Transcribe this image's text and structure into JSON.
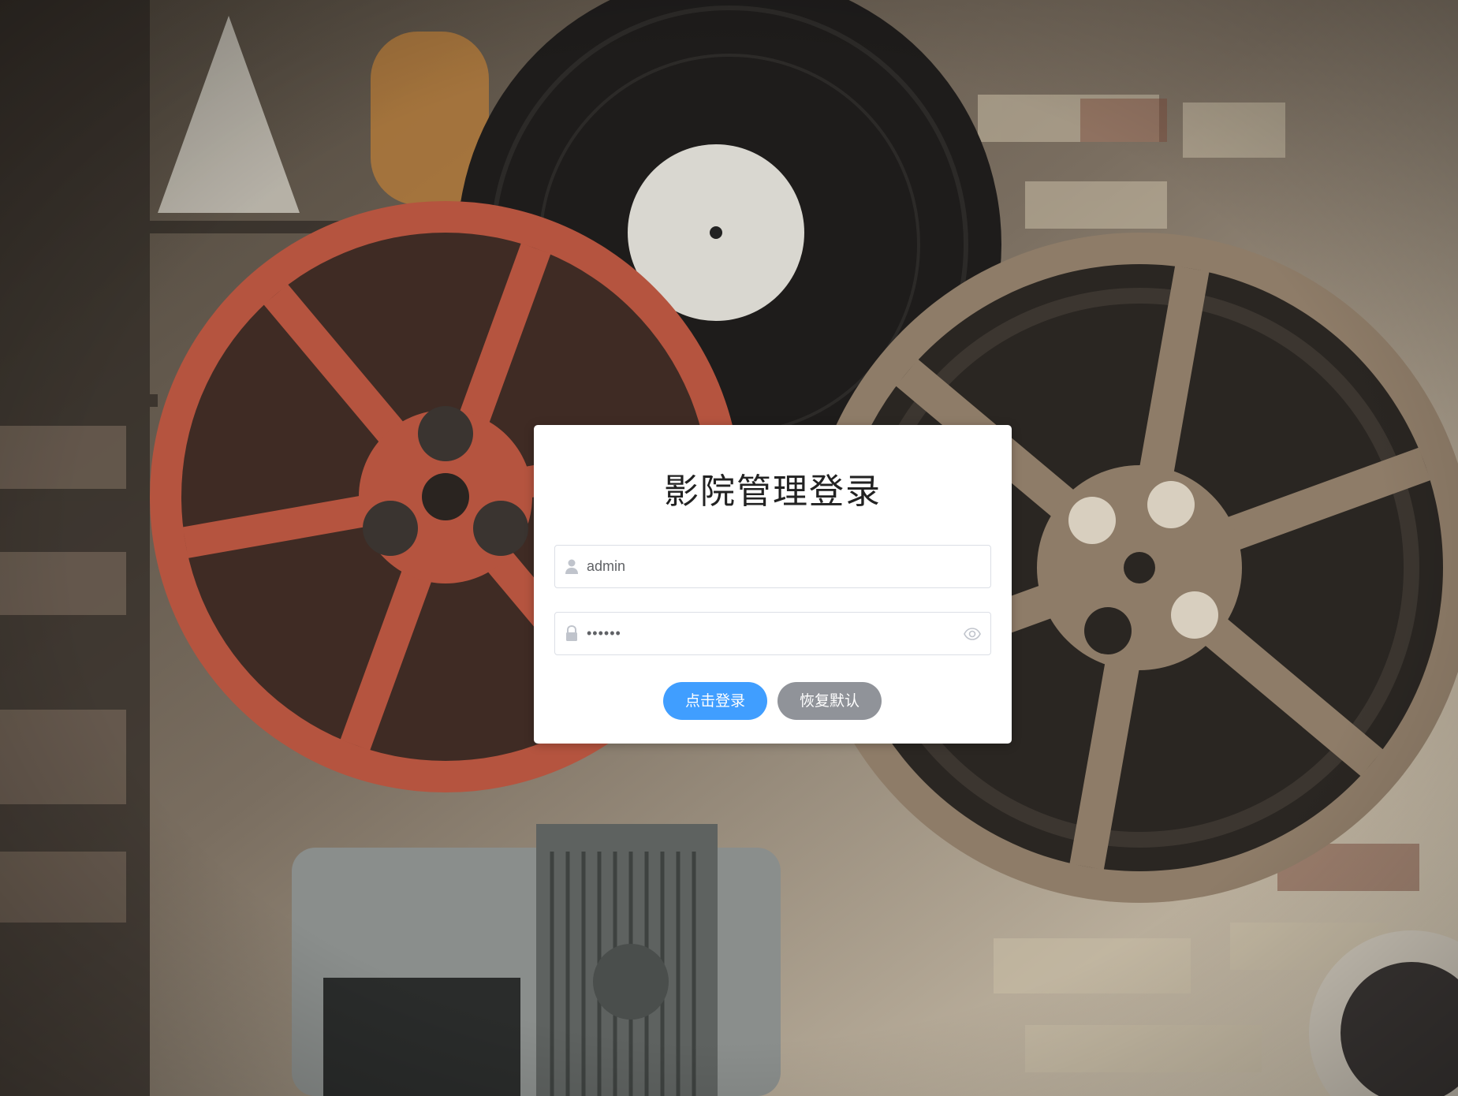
{
  "login": {
    "title": "影院管理登录",
    "username": {
      "value": "admin",
      "icon": "user-icon"
    },
    "password": {
      "value": "••••••",
      "icon": "lock-icon",
      "toggle_icon": "eye-icon"
    },
    "buttons": {
      "login_label": "点击登录",
      "reset_label": "恢复默认"
    }
  },
  "colors": {
    "primary": "#409eff",
    "info": "#909399",
    "card_bg": "#ffffff",
    "border": "#dcdfe6"
  },
  "background": {
    "description_icons": [
      "film-reel-red",
      "film-reel-bronze",
      "vinyl-record",
      "film-projector"
    ]
  }
}
